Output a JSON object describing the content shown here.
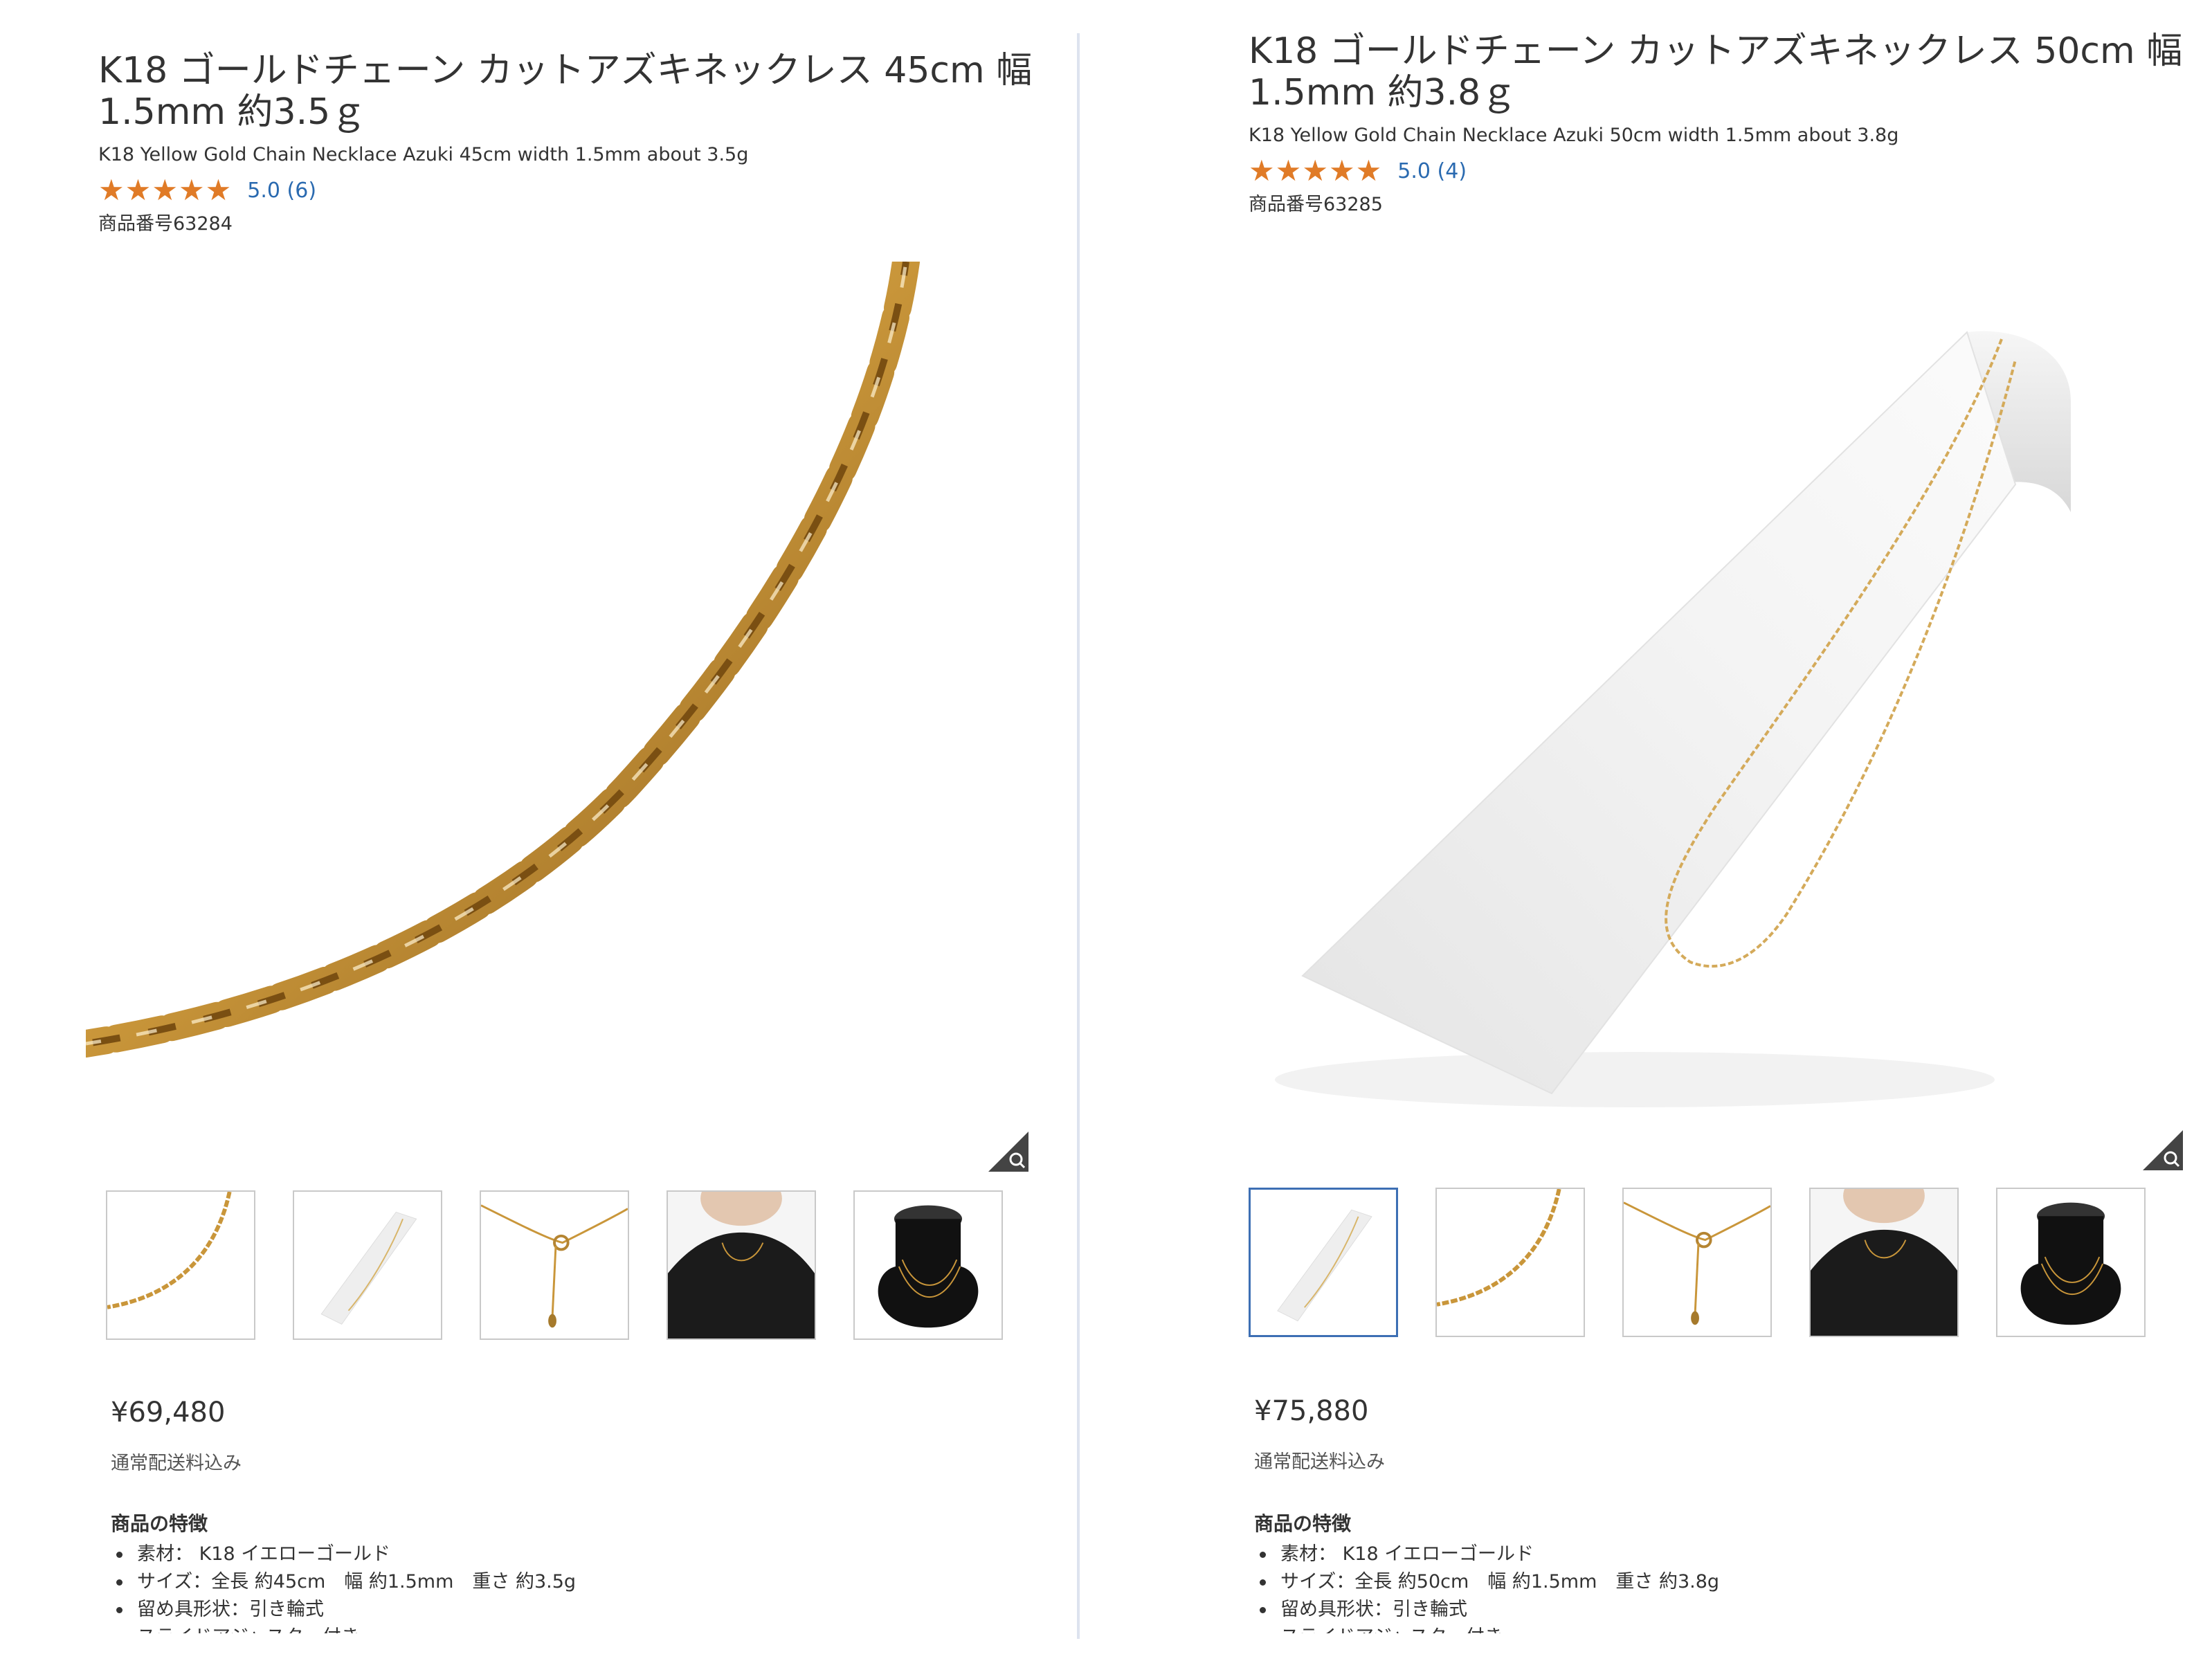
{
  "left": {
    "title_line1": "K18 ゴールドチェーン カットアズキネックレス 45cm 幅",
    "title_line2": "1.5mm 約3.5ｇ",
    "subtitle": "K18 Yellow Gold Chain Necklace Azuki 45cm width 1.5mm about 3.5g",
    "rating": 5.0,
    "rating_text": "5.0 (6)",
    "sku": "商品番号63284",
    "price": "¥69,480",
    "shipping": "通常配送料込み",
    "features_title": "商品の特徴",
    "features": [
      "素材： K18 イエローゴールド",
      "サイズ：全長 約45cm　幅 約1.5mm　重さ 約3.5g",
      "留め具形状：引き輪式",
      "スライドアジャスター付き"
    ],
    "thumbnails": [
      "chain-closeup",
      "chain-on-display-stand",
      "clasp-and-adjuster",
      "model-wearing",
      "neck-bust-display"
    ],
    "selected_thumbnail": 0
  },
  "right": {
    "title_line1": "K18 ゴールドチェーン カットアズキネックレス 50cm 幅",
    "title_line2": "1.5mm 約3.8ｇ",
    "subtitle": "K18 Yellow Gold Chain Necklace Azuki 50cm width 1.5mm about 3.8g",
    "rating": 5.0,
    "rating_text": "5.0 (4)",
    "sku": "商品番号63285",
    "price": "¥75,880",
    "shipping": "通常配送料込み",
    "features_title": "商品の特徴",
    "features": [
      "素材： K18 イエローゴールド",
      "サイズ：全長 約50cm　幅 約1.5mm　重さ 約3.8g",
      "留め具形状：引き輪式",
      "スライドアジャスター付き"
    ],
    "thumbnails": [
      "chain-on-display-stand",
      "chain-closeup",
      "clasp-and-adjuster",
      "model-wearing",
      "neck-bust-display"
    ],
    "selected_thumbnail": 0
  },
  "colors": {
    "star": "#e07b27",
    "rating_link": "#2a6ab0",
    "gold": "#c9963a",
    "selected_border": "#3d6fb4",
    "divider": "#dde3ef"
  }
}
